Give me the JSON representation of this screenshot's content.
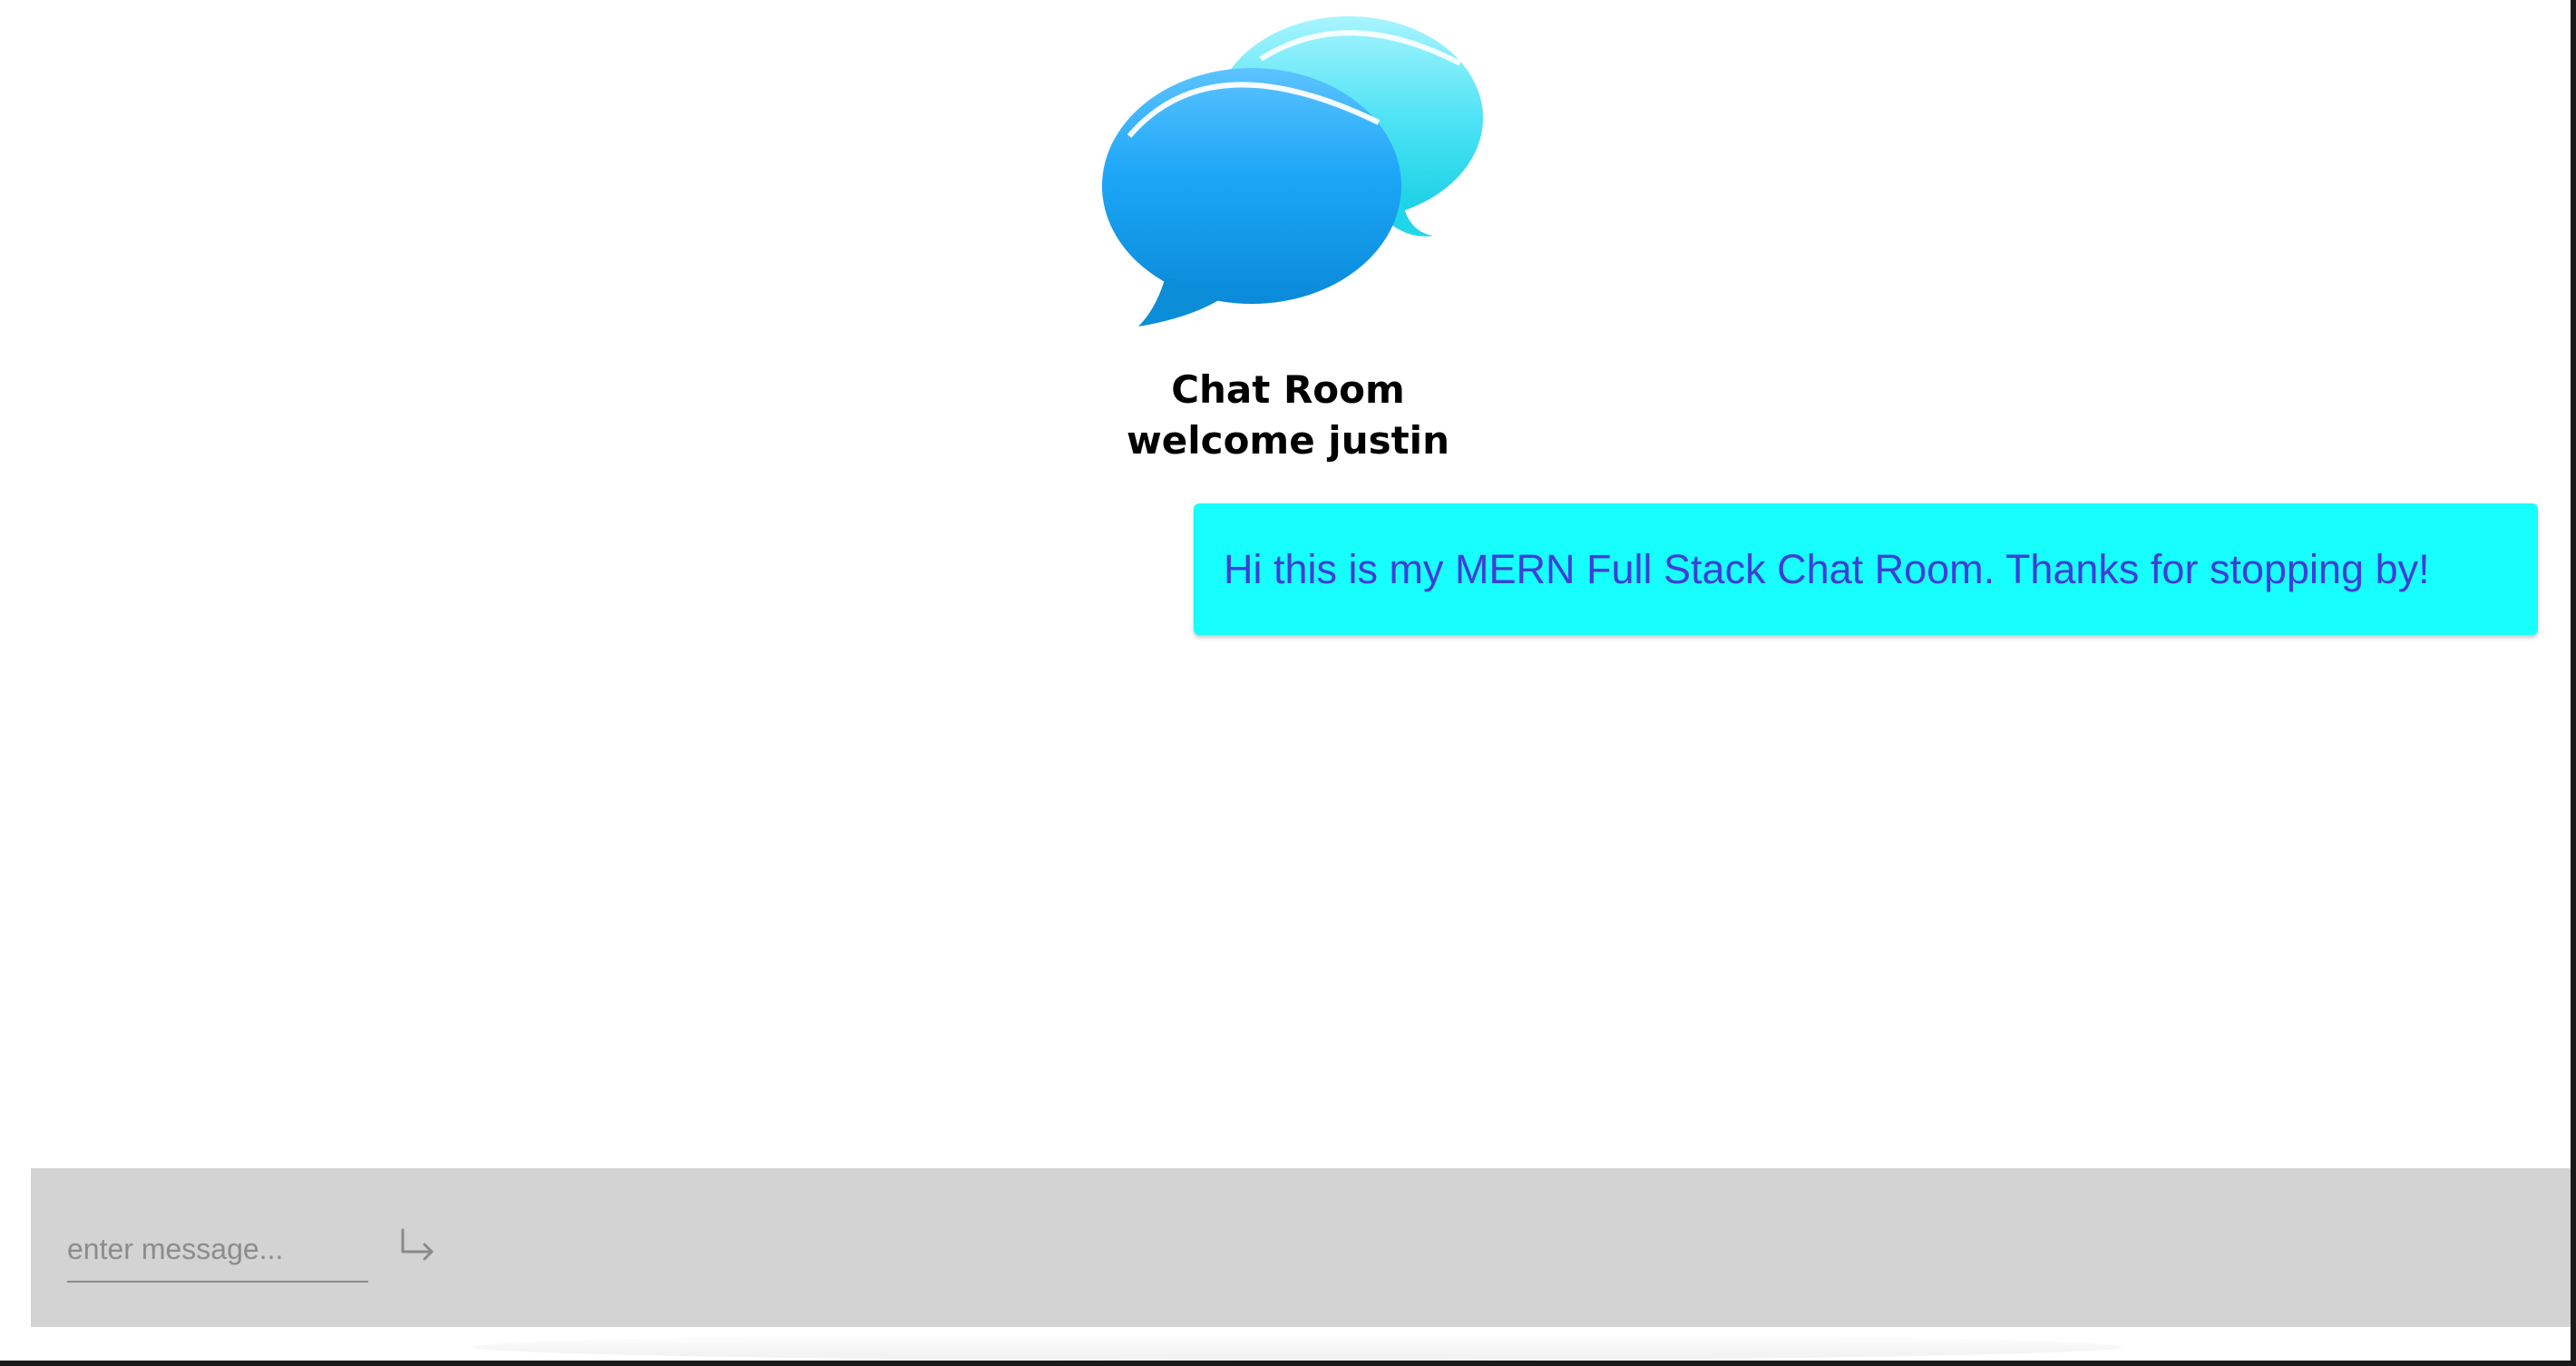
{
  "header": {
    "logo_icon": "chat-bubbles-icon",
    "title": "Chat Room",
    "welcome": "welcome justin"
  },
  "messages": [
    {
      "text": "Hi this is my MERN Full Stack Chat Room. Thanks for stopping by!",
      "bubble_color": "#17feff",
      "text_color": "#3f3fd6"
    }
  ],
  "composer": {
    "placeholder": "enter message...",
    "value": "",
    "send_icon": "enter-arrow-icon",
    "background": "#d3d3d3"
  }
}
